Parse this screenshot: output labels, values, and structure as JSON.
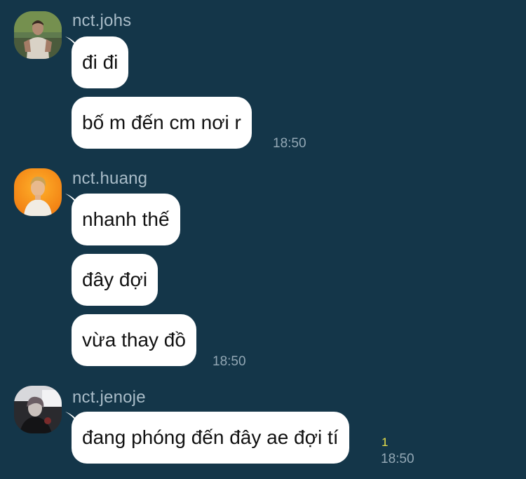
{
  "chat": {
    "groups": [
      {
        "sender": "nct.johs",
        "avatar_icon": "profile-photo-man-tank-top",
        "messages": [
          "đi đi",
          "bố m đến cm nơi r"
        ],
        "time": "18:50"
      },
      {
        "sender": "nct.huang",
        "avatar_icon": "profile-photo-orange-background",
        "messages": [
          "nhanh thế",
          "đây đợi",
          "vừa thay đồ"
        ],
        "time": "18:50"
      },
      {
        "sender": "nct.jenoje",
        "avatar_icon": "profile-photo-dark-background",
        "messages": [
          "đang phóng đến đây ae đợi tí"
        ],
        "unread_count": "1",
        "time": "18:50"
      }
    ]
  },
  "colors": {
    "background": "#143649",
    "bubble": "#ffffff",
    "sender_name": "#a9bcc8",
    "timestamp": "#93a8b5",
    "unread_count": "#e8e04a"
  }
}
